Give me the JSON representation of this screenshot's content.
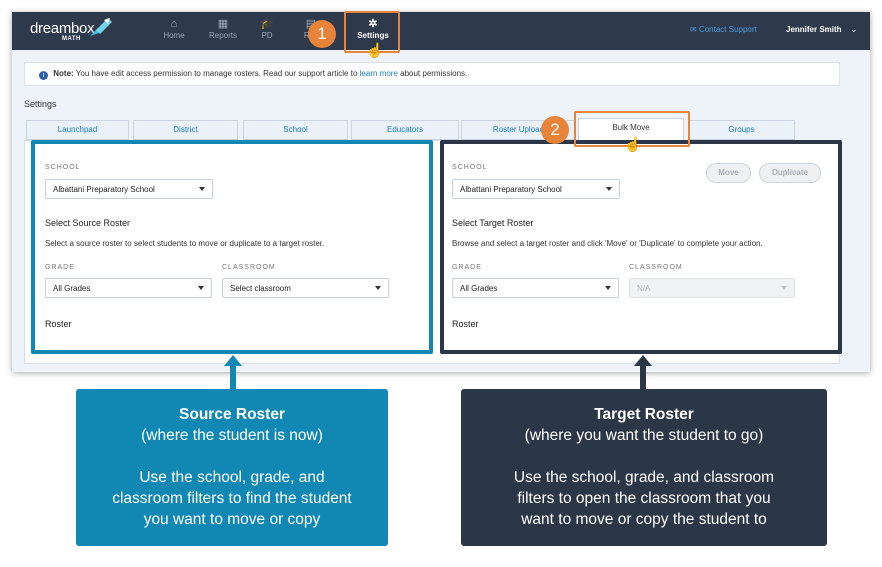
{
  "brand": {
    "name": "dreambox",
    "sub": "MATH"
  },
  "nav": {
    "items": [
      {
        "label": "Home",
        "icon": "home-icon",
        "glyph": "⌂"
      },
      {
        "label": "Reports",
        "icon": "grid-icon",
        "glyph": "▦"
      },
      {
        "label": "PD",
        "icon": "graduation-cap-icon",
        "glyph": "🎓"
      },
      {
        "label": "Res",
        "icon": "resources-icon",
        "glyph": "▤"
      },
      {
        "label": "Settings",
        "icon": "gear-icon",
        "glyph": "✲"
      }
    ],
    "contact": "Contact Support",
    "user": "Jennifer Smith"
  },
  "steps": {
    "one": "1",
    "two": "2"
  },
  "note": {
    "prefix": "Note:",
    "text": "You have edit access permission to manage rosters. Read our support article to",
    "link": "learn more",
    "suffix": "about permissions."
  },
  "page_title": "Settings",
  "tabs": [
    "Launchpad",
    "District",
    "School",
    "Educators",
    "Roster Upload",
    "Bulk Move",
    "Groups"
  ],
  "source": {
    "school_label": "SCHOOL",
    "school_value": "Albattani Preparatory School",
    "heading": "Select Source Roster",
    "description": "Select a source roster to select students to move or duplicate to a target roster.",
    "grade_label": "GRADE",
    "grade_value": "All Grades",
    "classroom_label": "CLASSROOM",
    "classroom_value": "Select classroom",
    "roster_label": "Roster"
  },
  "target": {
    "school_label": "SCHOOL",
    "school_value": "Albattani Preparatory School",
    "move_button": "Move",
    "duplicate_button": "Duplicate",
    "heading": "Select Target Roster",
    "description": "Browse and select a target roster and click 'Move' or 'Duplicate' to complete your action.",
    "grade_label": "GRADE",
    "grade_value": "All Grades",
    "classroom_label": "CLASSROOM",
    "classroom_value": "N/A",
    "roster_label": "Roster"
  },
  "callouts": {
    "source": {
      "title": "Source Roster",
      "subtitle": "(where the student is now)",
      "body1": "Use the school, grade, and",
      "body2": "classroom filters to find the student",
      "body3": "you want to move or copy"
    },
    "target": {
      "title": "Target Roster",
      "subtitle": "(where you want the student to go)",
      "body1": "Use the school, grade, and classroom",
      "body2": "filters to open the classroom that you",
      "body3": "want to move or copy the student to"
    }
  },
  "colors": {
    "navbar": "#2e3a4c",
    "accent_orange": "#e8833a",
    "source_blue": "#1088b3",
    "target_dark": "#2b3647",
    "link_blue": "#1e7bc6"
  }
}
